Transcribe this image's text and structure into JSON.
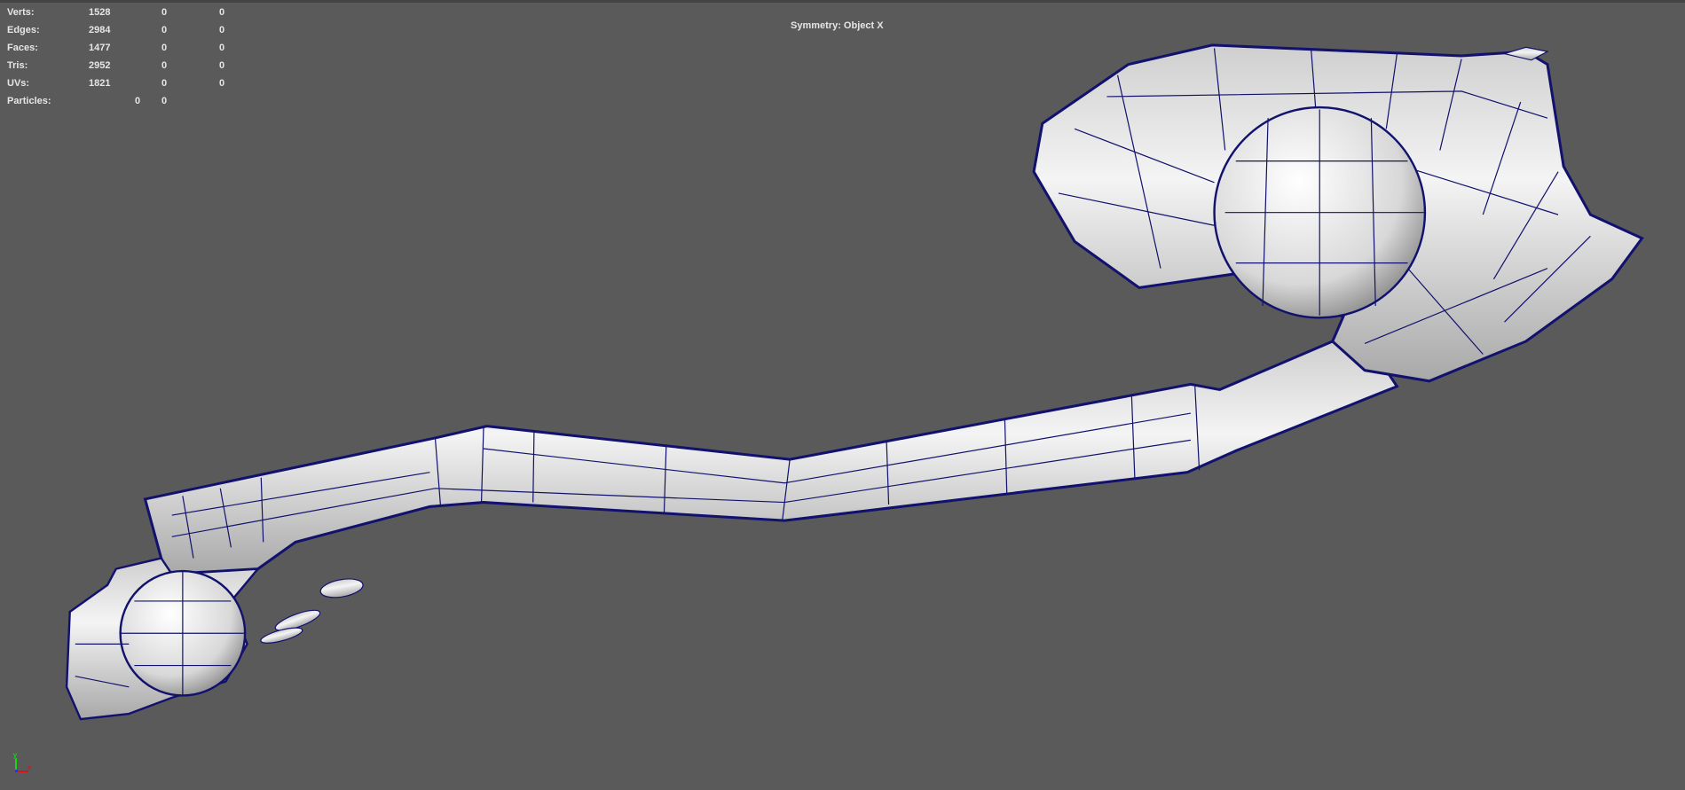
{
  "hud": {
    "rows": [
      {
        "label": "Verts:",
        "values": [
          "1528",
          "0",
          "0"
        ]
      },
      {
        "label": "Edges:",
        "values": [
          "2984",
          "0",
          "0"
        ]
      },
      {
        "label": "Faces:",
        "values": [
          "1477",
          "0",
          "0"
        ]
      },
      {
        "label": "Tris:",
        "values": [
          "2952",
          "0",
          "0"
        ]
      },
      {
        "label": "UVs:",
        "values": [
          "1821",
          "0",
          "0"
        ]
      }
    ],
    "particles": {
      "label": "Particles:",
      "values": [
        "0",
        "0"
      ]
    }
  },
  "symmetry": "Symmetry: Object X",
  "axis": {
    "x": "x",
    "y": "y"
  },
  "colors": {
    "background": "#5a5a5a",
    "wire": "#1a1a7a",
    "mesh": "#e4e4e4"
  }
}
